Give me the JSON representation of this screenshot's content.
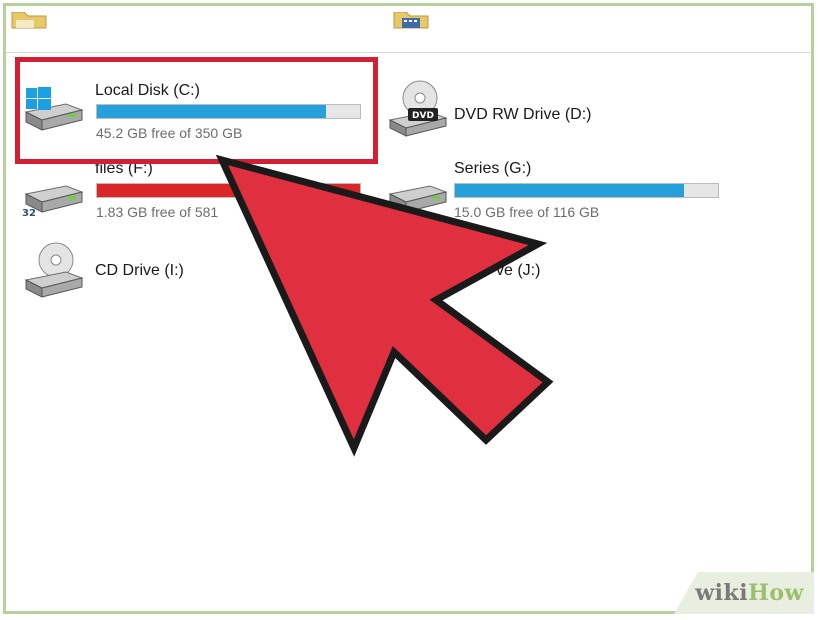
{
  "drives": [
    {
      "name": "Local Disk (C:)",
      "free": "45.2 GB free of 350 GB",
      "used_fraction": 0.87,
      "bar_color": "#26a0da",
      "icon": "windows-hard-drive-icon"
    },
    {
      "name": "DVD RW Drive (D:)",
      "free": "",
      "used_fraction": null,
      "bar_color": "",
      "icon": "dvd-drive-icon"
    },
    {
      "name": "files (F:)",
      "free": "1.83 GB free of 581",
      "used_fraction": 1.0,
      "bar_color": "#da2626",
      "icon": "hard-drive-icon"
    },
    {
      "name": "Series (G:)",
      "free": "15.0 GB free of 116 GB",
      "used_fraction": 0.87,
      "bar_color": "#26a0da",
      "icon": "hard-drive-icon"
    },
    {
      "name": "CD Drive (I:)",
      "free": "",
      "used_fraction": null,
      "bar_color": "",
      "icon": "cd-drive-icon"
    },
    {
      "name": "ve (J:)",
      "free": "",
      "used_fraction": null,
      "bar_color": "",
      "icon": "hard-drive-icon"
    }
  ],
  "watermark": {
    "wiki": "wiki",
    "how": "How"
  },
  "colors": {
    "highlight": "#d21f34",
    "arrow": "#e0303f",
    "frame": "#b7cf9a"
  }
}
